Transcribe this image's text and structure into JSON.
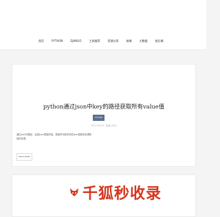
{
  "nav": {
    "items": [
      {
        "label": "首页"
      },
      {
        "label": "PYTHON"
      },
      {
        "label": "DJANGO"
      },
      {
        "label": "工具推荐"
      },
      {
        "label": "资源分享"
      },
      {
        "label": "前端"
      },
      {
        "label": "大数据"
      },
      {
        "label": "前后端"
      }
    ]
  },
  "post": {
    "title": "python通过json中key的路径获取所有value值",
    "tag": "PYTHON",
    "meta": "2021-09-03 · 阅读 (260)",
    "excerpt": "通过json的路径，返回json里面的值，里面有可能有多层json嵌套的处理和值的处理。",
    "read_more": "READ MORE"
  },
  "watermark": {
    "text": "千狐秒收录"
  },
  "colors": {
    "tag_bg": "#5a6f8c",
    "watermark_red": "#d4361f"
  }
}
